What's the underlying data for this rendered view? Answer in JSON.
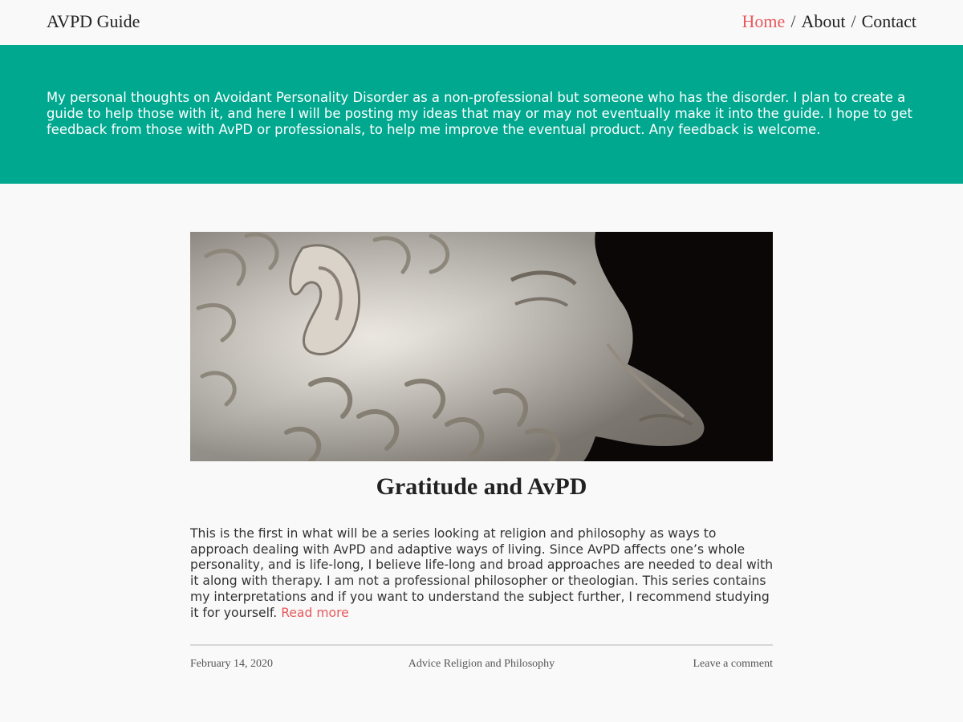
{
  "site": {
    "title": "AVPD Guide"
  },
  "nav": {
    "items": [
      {
        "label": "Home",
        "active": true
      },
      {
        "label": "About",
        "active": false
      },
      {
        "label": "Contact",
        "active": false
      }
    ],
    "separator": "/"
  },
  "banner": {
    "description": "My personal thoughts on Avoidant Personality Disorder as a non-professional but someone who has the disorder. I plan to create a guide to help those with it, and here I will be posting my ideas that may or may not eventually make it into the guide. I hope to get feedback from those with AvPD or professionals, to help me improve the eventual product. Any feedback is welcome."
  },
  "post": {
    "title": "Gratitude and AvPD",
    "excerpt": "This is the first in what will be a series looking at religion and philosophy as ways to approach dealing with AvPD and adaptive ways of living. Since AvPD affects one’s whole personality, and is life-long, I believe life-long and broad approaches are needed to deal with it along with therapy. I am not a professional philosopher or theologian. This series contains my interpretations and if you want to understand the subject further, I recommend studying it for yourself.",
    "read_more": "Read more",
    "date": "February 14, 2020",
    "categories": "Advice Religion and Philosophy",
    "comment_link": "Leave a comment"
  },
  "colors": {
    "accent": "#e8595c",
    "banner": "#00a88f",
    "background": "#f9f9f9"
  }
}
